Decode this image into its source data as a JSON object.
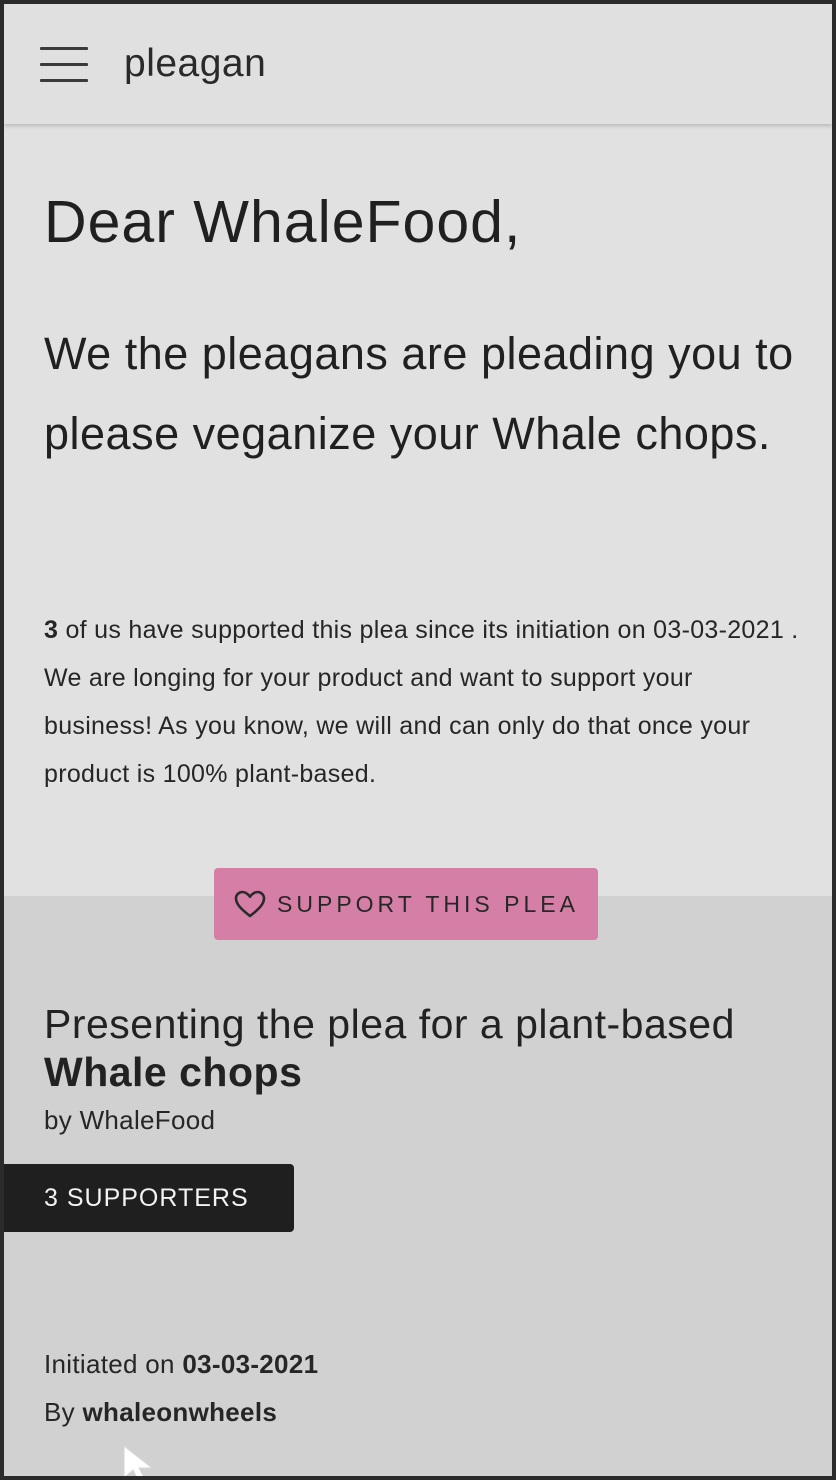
{
  "header": {
    "brand": "pleagan"
  },
  "plea": {
    "salutation": "Dear WhaleFood,",
    "request": "We the pleagans are pleading you to please veganize your Whale chops.",
    "support_count": "3",
    "support_text_1": "of us have supported this plea since its initiation on",
    "initiation_date": "03-03-2021",
    "support_text_2": ". We are longing for your product and want to support your business! As you know, we will and can only do that once your product is 100% plant-based.",
    "support_button_label": "SUPPORT THIS PLEA"
  },
  "details": {
    "title_prefix": "Presenting the plea for a plant-based",
    "product": "Whale chops",
    "by_company": "by WhaleFood",
    "supporters_badge": "3 SUPPORTERS",
    "initiated_label": "Initiated on",
    "initiated_date": "03-03-2021",
    "author_label": "By",
    "author": "whaleonwheels"
  },
  "icons": {
    "menu": "hamburger-menu-icon",
    "support": "heart-outline-icon",
    "cursor": "mouse-pointer-icon"
  },
  "colors": {
    "header_background": "#e0e0e0",
    "hero_background": "#e1e1e1",
    "content_background": "#d1d1d1",
    "support_button": "#d67fa6",
    "supporters_badge": "#1f1f1f"
  }
}
